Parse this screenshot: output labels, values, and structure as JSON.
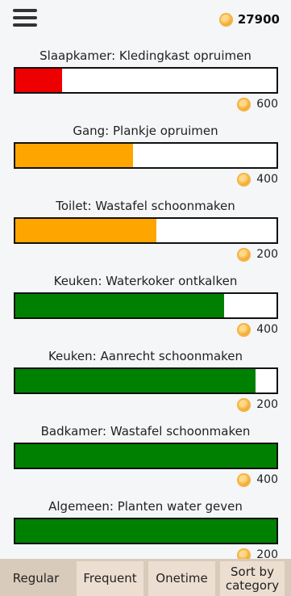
{
  "header": {
    "balance": "27900",
    "coin_icon": "coin-icon",
    "menu_icon": "hamburger-menu-icon"
  },
  "tasks": [
    {
      "title": "Slaapkamer: Kledingkast opruimen",
      "progress": 0.18,
      "color": "#ee0000",
      "reward": "600"
    },
    {
      "title": "Gang: Plankje opruimen",
      "progress": 0.45,
      "color": "#ffa500",
      "reward": "400"
    },
    {
      "title": "Toilet: Wastafel schoonmaken",
      "progress": 0.54,
      "color": "#ffa500",
      "reward": "200"
    },
    {
      "title": "Keuken: Waterkoker ontkalken",
      "progress": 0.8,
      "color": "#008000",
      "reward": "400"
    },
    {
      "title": "Keuken: Aanrecht schoonmaken",
      "progress": 0.92,
      "color": "#008000",
      "reward": "200"
    },
    {
      "title": "Badkamer: Wastafel schoonmaken",
      "progress": 1.0,
      "color": "#008000",
      "reward": "400"
    },
    {
      "title": "Algemeen: Planten water geven",
      "progress": 1.0,
      "color": "#008000",
      "reward": "200"
    }
  ],
  "nav": {
    "regular": "Regular",
    "frequent": "Frequent",
    "onetime": "Onetime",
    "category_line1": "Sort by",
    "category_line2": "category"
  }
}
